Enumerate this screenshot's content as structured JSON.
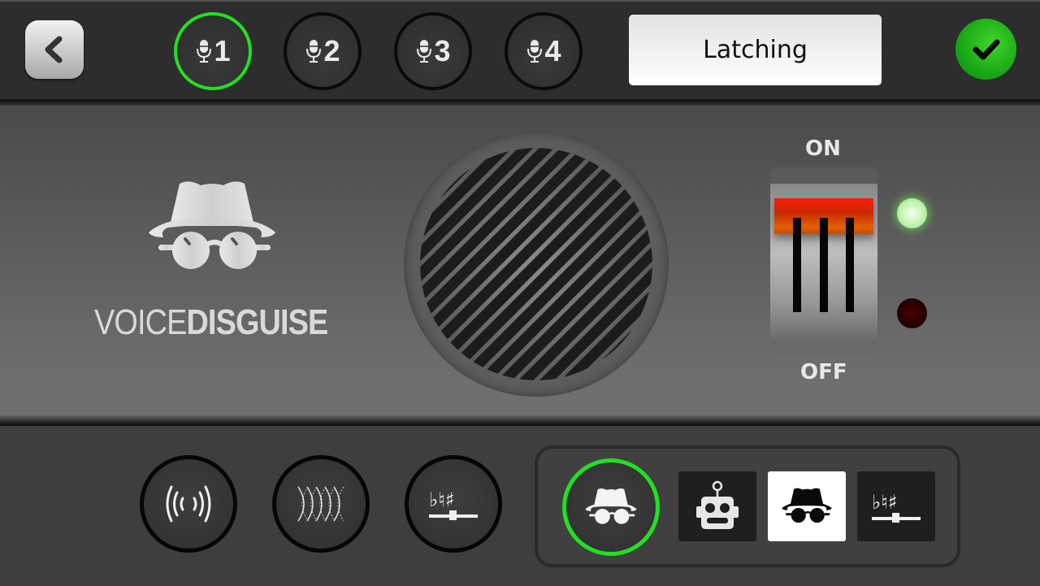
{
  "topbar": {
    "back_button": {
      "icon": "chevron-left-icon"
    },
    "mic_channels": [
      {
        "label": "1",
        "icon": "microphone-icon",
        "active": true
      },
      {
        "label": "2",
        "icon": "microphone-icon",
        "active": false
      },
      {
        "label": "3",
        "icon": "microphone-icon",
        "active": false
      },
      {
        "label": "4",
        "icon": "microphone-icon",
        "active": false
      }
    ],
    "mode_button": {
      "label": "Latching"
    },
    "confirm_button": {
      "icon": "checkmark-icon"
    }
  },
  "main": {
    "brand": {
      "icon": "incognito-spy-icon",
      "name_light": "VOICE",
      "name_bold": "DISGUISE"
    },
    "speaker": {
      "icon": "speaker-grille"
    },
    "power_switch": {
      "on_label": "ON",
      "off_label": "OFF",
      "state": "on",
      "on_led_lit": true,
      "off_led_lit": false
    }
  },
  "bottom": {
    "effects": [
      {
        "name": "broadcast",
        "icon": "broadcast-waves-icon"
      },
      {
        "name": "echo",
        "icon": "echo-waves-icon"
      },
      {
        "name": "pitch",
        "icon": "pitch-flat-natural-sharp-icon",
        "symbols": "♭♮♯"
      }
    ],
    "presets": {
      "current": {
        "icon": "incognito-spy-icon"
      },
      "options": [
        {
          "name": "robot",
          "icon": "robot-icon",
          "selected": false
        },
        {
          "name": "spy",
          "icon": "incognito-spy-icon",
          "selected": true
        },
        {
          "name": "pitch",
          "icon": "pitch-flat-natural-sharp-icon",
          "symbols": "♭♮♯",
          "selected": false
        }
      ]
    }
  },
  "colors": {
    "active_ring": "#22e022",
    "confirm_green": "#14a014",
    "lever_red": "#ff1a0a",
    "lever_orange": "#e26000",
    "led_green": "#c6f5b4",
    "led_red_off": "#200000"
  }
}
